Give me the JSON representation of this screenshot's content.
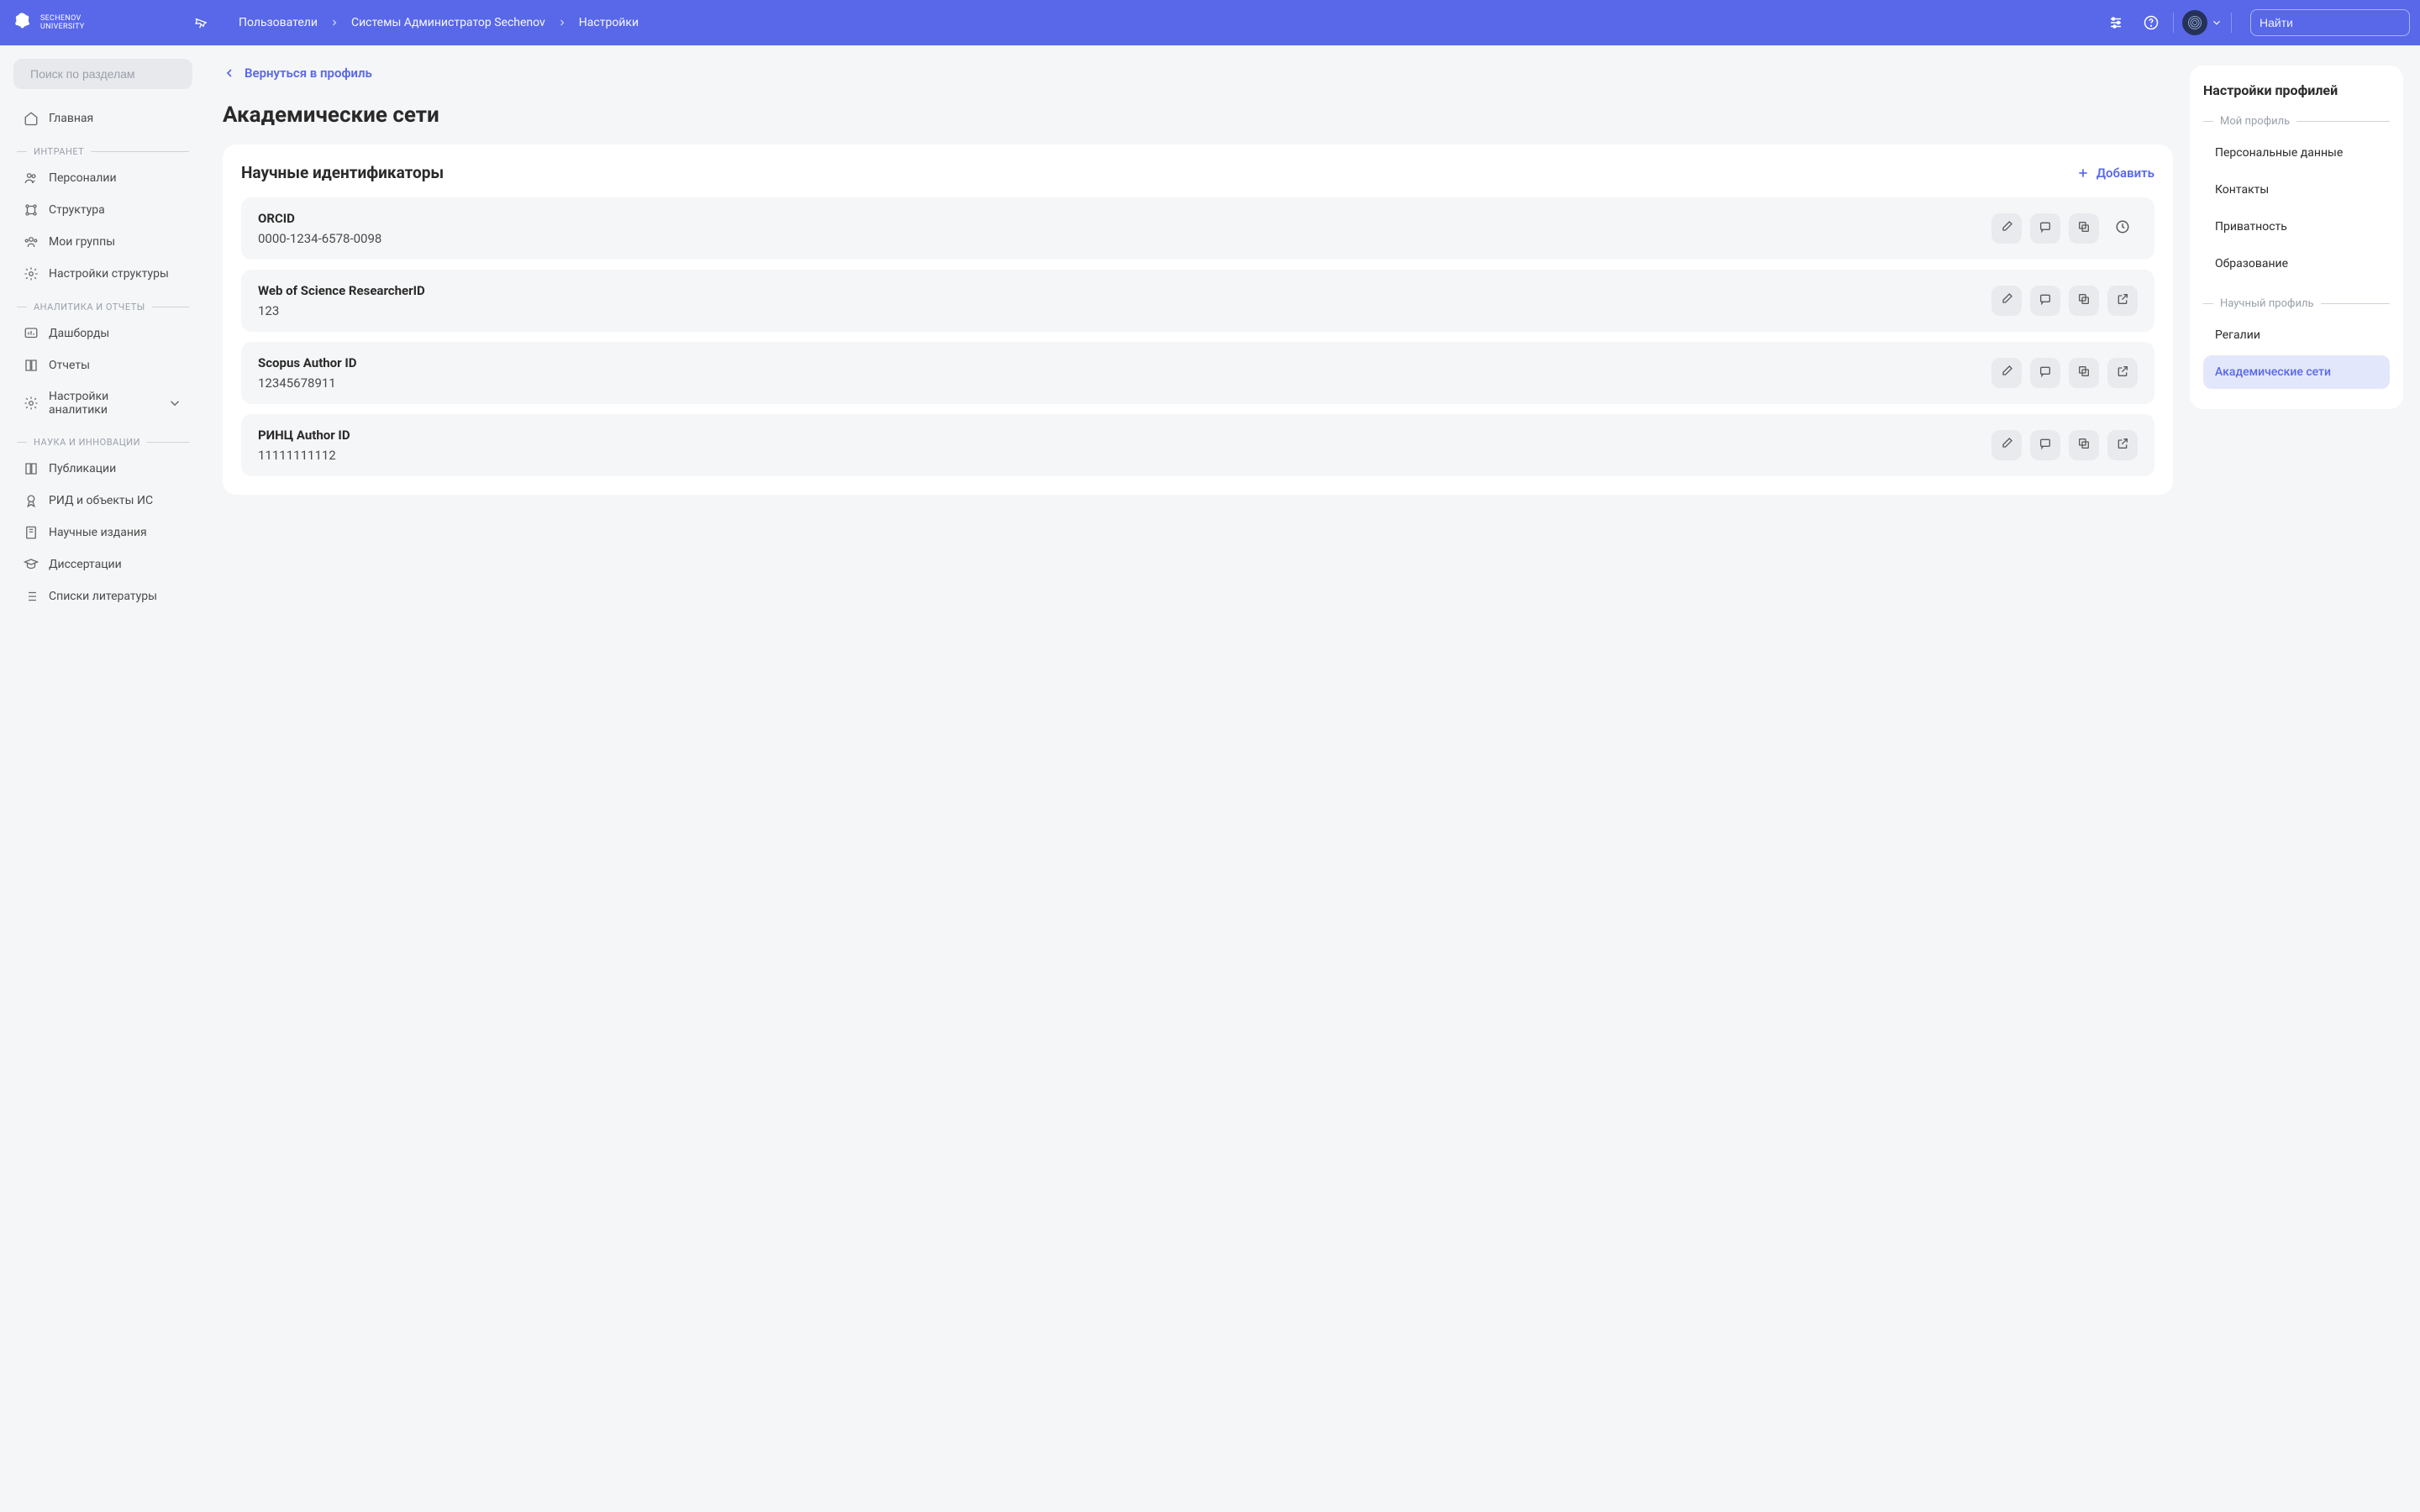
{
  "header": {
    "logo_line1": "SECHENOV",
    "logo_line2": "UNIVERSITY",
    "breadcrumb": [
      "Пользователи",
      "Системы Администратор Sechenov",
      "Настройки"
    ],
    "search_placeholder": "Найти"
  },
  "sidebar": {
    "search_placeholder": "Поиск по разделам",
    "items0": {
      "label": "Главная"
    },
    "groups": [
      {
        "label": "ИНТРАНЕТ",
        "items": [
          {
            "label": "Персоналии"
          },
          {
            "label": "Структура"
          },
          {
            "label": "Мои группы"
          },
          {
            "label": "Настройки структуры"
          }
        ]
      },
      {
        "label": "АНАЛИТИКА И ОТЧЕТЫ",
        "items": [
          {
            "label": "Дашборды"
          },
          {
            "label": "Отчеты"
          },
          {
            "label": "Настройки аналитики"
          }
        ]
      },
      {
        "label": "НАУКА И ИННОВАЦИИ",
        "items": [
          {
            "label": "Публикации"
          },
          {
            "label": "РИД и объекты ИС"
          },
          {
            "label": "Научные издания"
          },
          {
            "label": "Диссертации"
          },
          {
            "label": "Списки литературы"
          }
        ]
      }
    ]
  },
  "content": {
    "back": "Вернуться в профиль",
    "title": "Академические сети",
    "card_title": "Научные идентификаторы",
    "add_label": "Добавить",
    "rows": [
      {
        "label": "ORCID",
        "value": "0000-1234-6578-0098",
        "open": false,
        "history": true
      },
      {
        "label": "Web of Science ResearcherID",
        "value": "123",
        "open": true,
        "history": false
      },
      {
        "label": "Scopus Author ID",
        "value": "12345678911",
        "open": true,
        "history": false
      },
      {
        "label": "РИНЦ Author ID",
        "value": "11111111112",
        "open": true,
        "history": false
      }
    ]
  },
  "right_panel": {
    "title": "Настройки профилей",
    "group1": "Мой профиль",
    "items1": [
      "Персональные данные",
      "Контакты",
      "Приватность",
      "Образование"
    ],
    "group2": "Научный профиль",
    "items2": [
      "Регалии",
      "Академические сети"
    ],
    "active": "Академические сети"
  }
}
